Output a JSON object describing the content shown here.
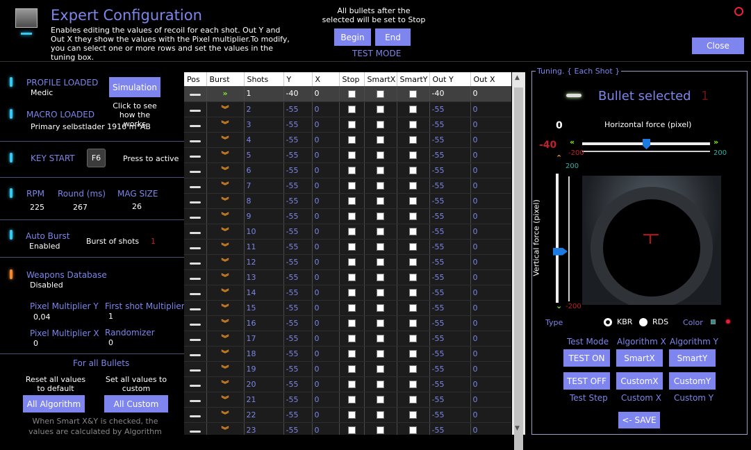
{
  "header": {
    "title": "Expert Configuration",
    "description": "Enables editing the values of recoil for each shot. Out Y and Out X they show the values with the Pixel multiplier.To modify, you can select one or more rows and set the values in the tuning box.",
    "bullets_note": "All bullets after the selected will be set to Stop",
    "begin": "Begin",
    "end": "End",
    "test_mode": "TEST MODE",
    "close": "Close"
  },
  "left": {
    "profile_label": "PROFILE LOADED",
    "profile_value": "Medic",
    "simulation": "Simulation",
    "click_hint": "Click to see how the works",
    "macro_label": "MACRO LOADED",
    "macro_value": "Primary selbstlader 1916 m*AB",
    "key_start_label": "KEY START",
    "key": "F6",
    "press_active": "Press to active",
    "rpm_label": "RPM",
    "rpm_value": "225",
    "round_label": "Round (ms)",
    "round_value": "267",
    "mag_label": "MAG SIZE",
    "mag_value": "26",
    "auto_burst_label": "Auto Burst",
    "auto_burst_value": "Enabled",
    "burst_of_shots": "Burst of shots",
    "burst_value": "1",
    "weapons_db_label": "Weapons Database",
    "weapons_db_value": "Disabled",
    "pixel_mult_y_label": "Pixel Multiplier Y",
    "pixel_mult_y_value": "0,04",
    "first_shot_label": "First shot Multiplier",
    "first_shot_value": "1",
    "pixel_mult_x_label": "Pixel Multiplier X",
    "pixel_mult_x_value": "0",
    "randomizer_label": "Randomizer",
    "randomizer_value": "0",
    "for_all_bullets": "For all Bullets",
    "reset_all": "Reset all values to default",
    "set_all": "Set all values to custom",
    "all_algorithm": "All Algorithm",
    "all_custom": "All Custom",
    "smart_note": "When Smart X&Y is checked, the values are calculated by Algorithm"
  },
  "table": {
    "columns": [
      "Pos",
      "Burst",
      "Shots",
      "Y",
      "X",
      "Stop",
      "SmartX",
      "SmartY",
      "Out Y",
      "Out X"
    ],
    "rows": [
      {
        "shot": "1",
        "y": "-40",
        "x": "0",
        "out_y": "-40",
        "out_x": "0"
      },
      {
        "shot": "2",
        "y": "-55",
        "x": "0",
        "out_y": "-55",
        "out_x": "0"
      },
      {
        "shot": "3",
        "y": "-55",
        "x": "0",
        "out_y": "-55",
        "out_x": "0"
      },
      {
        "shot": "4",
        "y": "-55",
        "x": "0",
        "out_y": "-55",
        "out_x": "0"
      },
      {
        "shot": "5",
        "y": "-55",
        "x": "0",
        "out_y": "-55",
        "out_x": "0"
      },
      {
        "shot": "6",
        "y": "-55",
        "x": "0",
        "out_y": "-55",
        "out_x": "0"
      },
      {
        "shot": "7",
        "y": "-55",
        "x": "0",
        "out_y": "-55",
        "out_x": "0"
      },
      {
        "shot": "8",
        "y": "-55",
        "x": "0",
        "out_y": "-55",
        "out_x": "0"
      },
      {
        "shot": "9",
        "y": "-55",
        "x": "0",
        "out_y": "-55",
        "out_x": "0"
      },
      {
        "shot": "10",
        "y": "-55",
        "x": "0",
        "out_y": "-55",
        "out_x": "0"
      },
      {
        "shot": "11",
        "y": "-55",
        "x": "0",
        "out_y": "-55",
        "out_x": "0"
      },
      {
        "shot": "12",
        "y": "-55",
        "x": "0",
        "out_y": "-55",
        "out_x": "0"
      },
      {
        "shot": "13",
        "y": "-55",
        "x": "0",
        "out_y": "-55",
        "out_x": "0"
      },
      {
        "shot": "14",
        "y": "-55",
        "x": "0",
        "out_y": "-55",
        "out_x": "0"
      },
      {
        "shot": "15",
        "y": "-55",
        "x": "0",
        "out_y": "-55",
        "out_x": "0"
      },
      {
        "shot": "16",
        "y": "-55",
        "x": "0",
        "out_y": "-55",
        "out_x": "0"
      },
      {
        "shot": "17",
        "y": "-55",
        "x": "0",
        "out_y": "-55",
        "out_x": "0"
      },
      {
        "shot": "18",
        "y": "-55",
        "x": "0",
        "out_y": "-55",
        "out_x": "0"
      },
      {
        "shot": "19",
        "y": "-55",
        "x": "0",
        "out_y": "-55",
        "out_x": "0"
      },
      {
        "shot": "20",
        "y": "-55",
        "x": "0",
        "out_y": "-55",
        "out_x": "0"
      },
      {
        "shot": "21",
        "y": "-55",
        "x": "0",
        "out_y": "-55",
        "out_x": "0"
      },
      {
        "shot": "22",
        "y": "-55",
        "x": "0",
        "out_y": "-55",
        "out_x": "0"
      },
      {
        "shot": "23",
        "y": "-55",
        "x": "0",
        "out_y": "-55",
        "out_x": "0"
      }
    ]
  },
  "tuning": {
    "group_title": "Tuning. { Each Shot }",
    "bullet_selected": "Bullet selected",
    "bullet_selected_value": "1",
    "h_value": "0",
    "v_value": "-40",
    "h_label": "Horizontal force (pixel)",
    "h_min": "-200",
    "h_max": "200",
    "h_level": 0,
    "v_label": "Vertical force (pixel)",
    "v_max": "200",
    "v_min": "-200",
    "v_level": -40,
    "type_label": "Type",
    "kbr": "KBR",
    "rds": "RDS",
    "color_label": "Color",
    "test_mode_label": "Test Mode",
    "algorithm_x_label": "Algorithm X",
    "algorithm_y_label": "Algorithm Y",
    "test_on": "TEST ON",
    "smart_x": "SmartX",
    "smart_y": "SmartY",
    "test_off": "TEST OFF",
    "custom_x": "CustomX",
    "custom_y": "CustomY",
    "test_step": "Test Step",
    "custom_x_label": "Custom X",
    "custom_y_label": "Custom Y",
    "save": "<- SAVE"
  },
  "colors": {
    "accent": "#7f85ee",
    "led_blue": "#38c9f2",
    "led_orange": "#f08a32",
    "chevron": "#ff9a1f"
  }
}
